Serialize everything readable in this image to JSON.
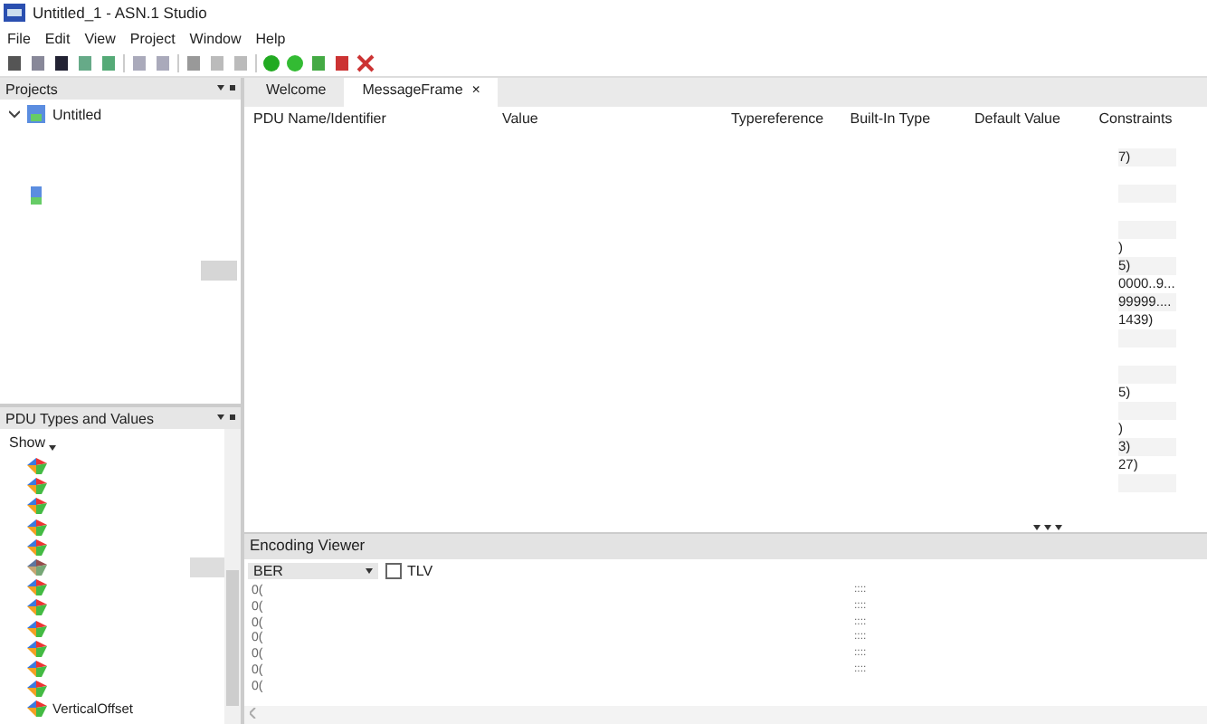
{
  "window": {
    "title": "Untitled_1 - ASN.1 Studio"
  },
  "menu": [
    "File",
    "Edit",
    "View",
    "Project",
    "Window",
    "Help"
  ],
  "projects": {
    "title": "Projects",
    "items": [
      {
        "label": "Untitled",
        "expanded": true
      }
    ]
  },
  "pdu_panel": {
    "title": "PDU Types and Values",
    "show": "Show",
    "items": [
      {
        "selected": false
      },
      {
        "selected": false
      },
      {
        "selected": false
      },
      {
        "selected": false
      },
      {
        "selected": false
      },
      {
        "selected": true
      },
      {
        "selected": false
      },
      {
        "selected": false
      },
      {
        "selected": false
      },
      {
        "selected": false
      },
      {
        "selected": false
      },
      {
        "selected": false
      },
      {
        "label": "VerticalOffset",
        "selected": false
      }
    ]
  },
  "tabs": [
    {
      "label": "Welcome",
      "selected": false
    },
    {
      "label": "MessageFrame",
      "selected": true,
      "close": "×"
    }
  ],
  "table": {
    "columns": [
      "PDU Name/Identifier",
      "Value",
      "Typereference",
      "Built-In Type",
      "Default Value",
      "Constraints"
    ],
    "rows": [
      {},
      {
        "constraints": "7)"
      },
      {},
      {},
      {},
      {},
      {
        "constraints": ")"
      },
      {
        "constraints": "5)"
      },
      {
        "constraints": "0000..9..."
      },
      {
        "constraints": "99999...."
      },
      {
        "constraints": "1439)"
      },
      {},
      {},
      {},
      {
        "constraints": "5)"
      },
      {},
      {
        "constraints": ")"
      },
      {
        "constraints": "3)"
      },
      {
        "constraints": "27)"
      },
      {},
      {}
    ]
  },
  "encoding": {
    "title": "Encoding Viewer",
    "format": "BER",
    "tlv": {
      "label": "TLV",
      "checked": false
    },
    "rows": [
      {
        "offset": "0(",
        "ascii": "::::"
      },
      {
        "offset": "0(",
        "ascii": "::::"
      },
      {
        "offset": "0(",
        "ascii": "::::"
      },
      {
        "offset": "0(",
        "ascii": "::::"
      },
      {
        "offset": "0(",
        "ascii": "::::"
      },
      {
        "offset": "0(",
        "ascii": "::::"
      },
      {
        "offset": "0("
      }
    ]
  }
}
